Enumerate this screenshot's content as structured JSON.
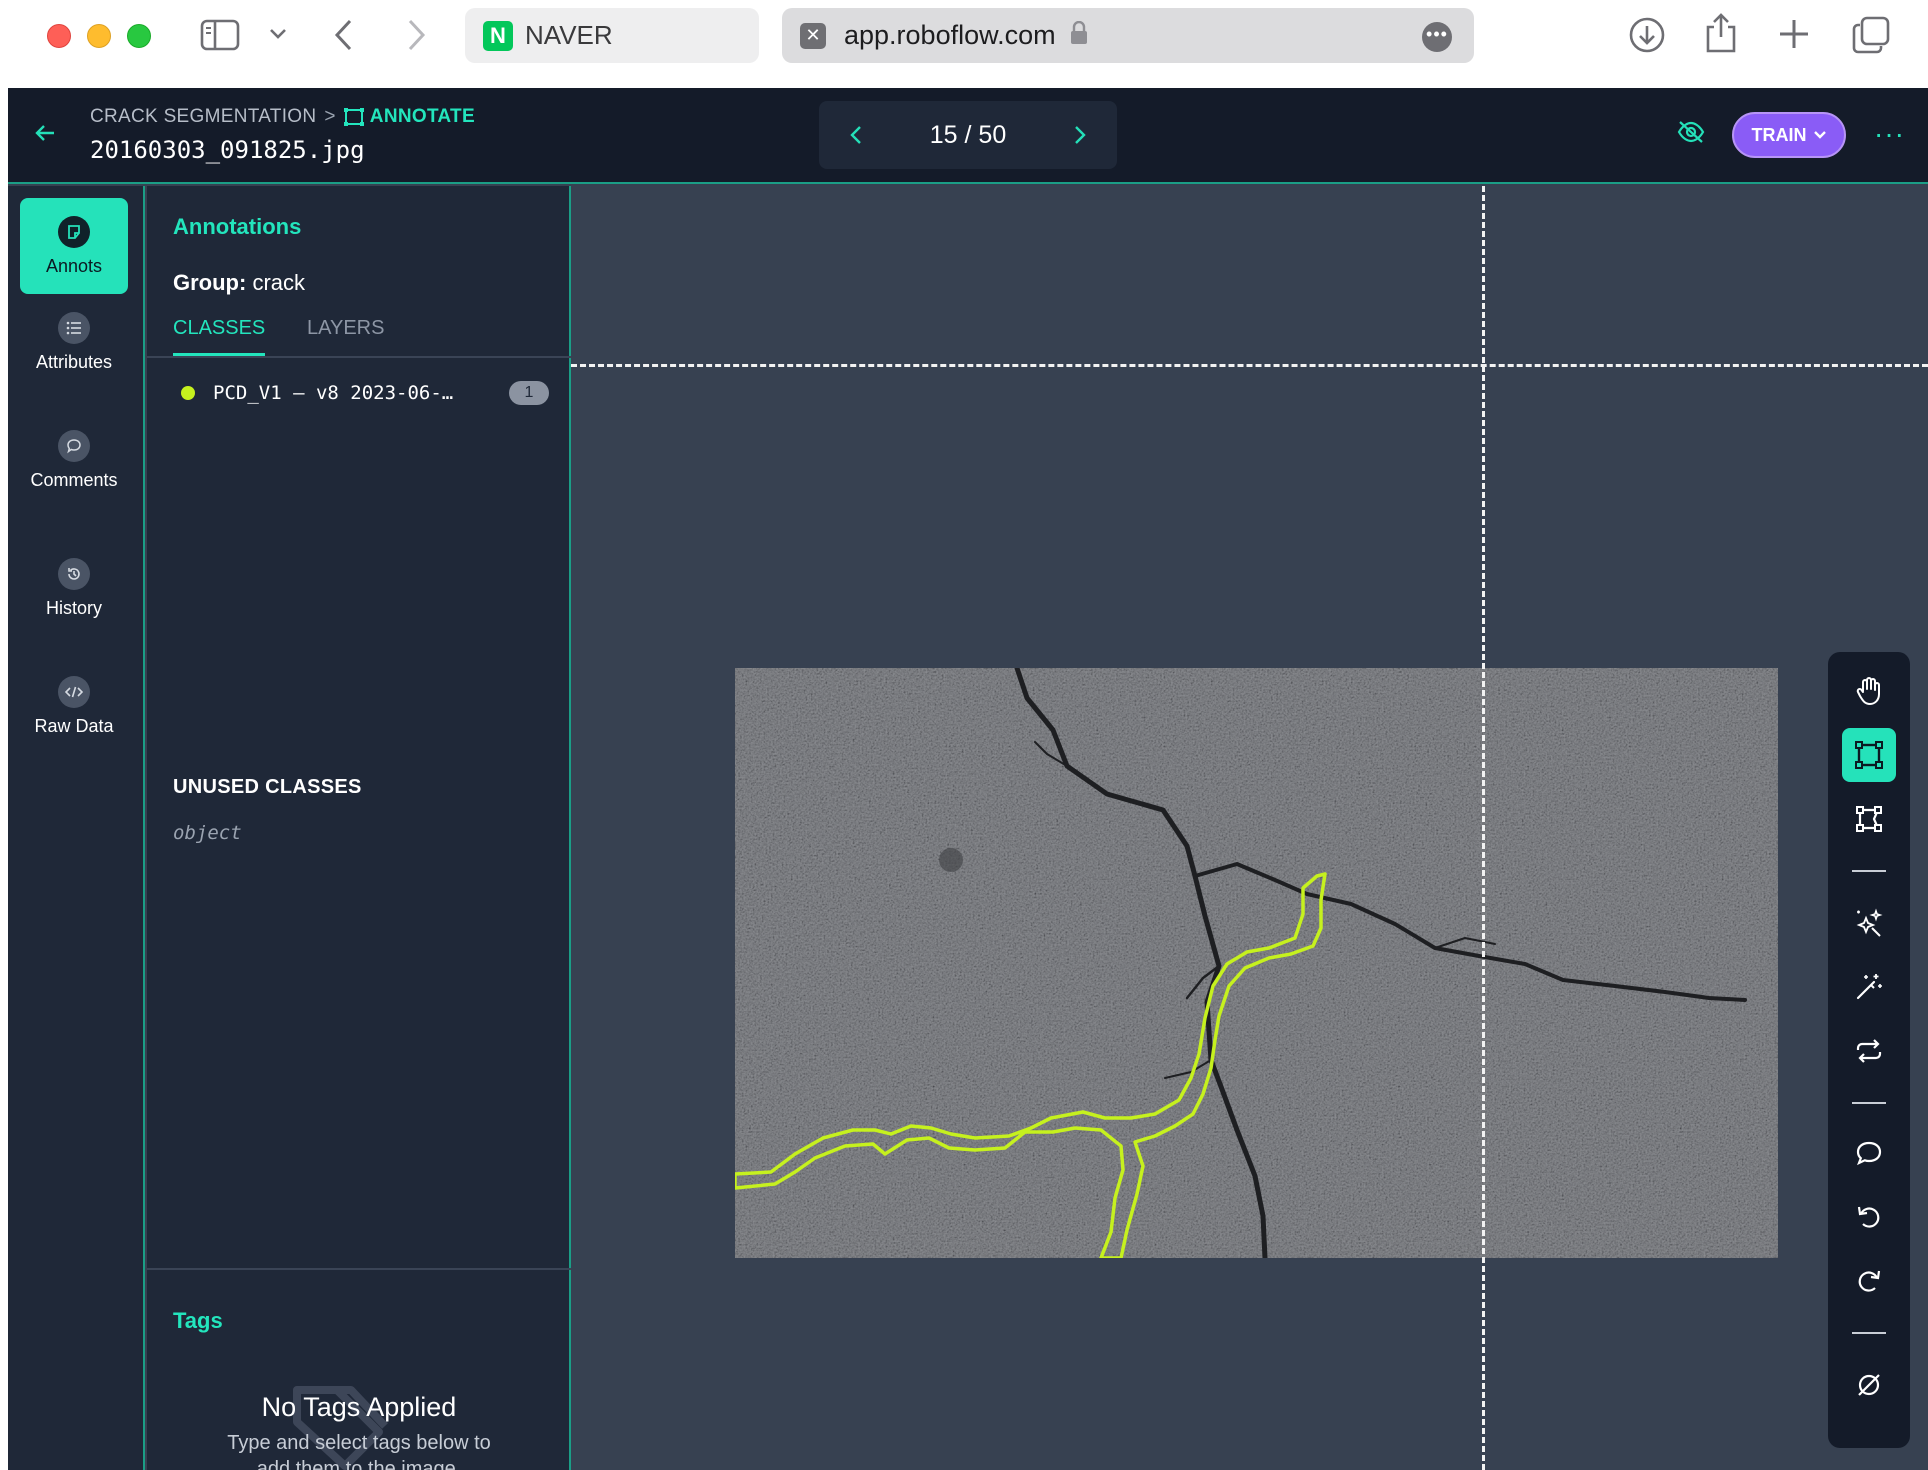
{
  "browser": {
    "tabs": [
      {
        "label": "NAVER",
        "icon": "naver-logo"
      },
      {
        "label": "app.roboflow.com",
        "icon": "close-icon"
      }
    ],
    "naver_logo_letter": "N",
    "more_dots": "•••"
  },
  "header": {
    "breadcrumb_project": "CRACK SEGMENTATION",
    "breadcrumb_separator": ">",
    "breadcrumb_current": "ANNOTATE",
    "file_name": "20160303_091825.jpg",
    "pager": "15 / 50",
    "train_label": "TRAIN",
    "more_label": "···"
  },
  "left_nav": {
    "items": [
      {
        "label": "Annots",
        "icon": "annotation-icon",
        "active": true
      },
      {
        "label": "Attributes",
        "icon": "list-icon"
      },
      {
        "label": "Comments",
        "icon": "comment-icon"
      },
      {
        "label": "History",
        "icon": "history-icon"
      },
      {
        "label": "Raw Data",
        "icon": "code-icon"
      }
    ]
  },
  "panel": {
    "title": "Annotations",
    "group_label": "Group:",
    "group_value": "crack",
    "tabs": [
      "CLASSES",
      "LAYERS"
    ],
    "classes": [
      {
        "name": "PCD_V1 – v8 2023-06-…",
        "count": "1",
        "color": "#c6f11e"
      }
    ],
    "unused_heading": "UNUSED CLASSES",
    "unused_classes": [
      "object"
    ],
    "tags_title": "Tags",
    "no_tags_title": "No Tags Applied",
    "no_tags_desc_1": "Type and select tags below to",
    "no_tags_desc_2": "add them to the image."
  },
  "toolbar": {
    "tools": [
      "hand-icon",
      "bounding-box-icon",
      "polygon-icon",
      "smart-polygon-icon",
      "magic-wand-icon",
      "repeat-icon",
      "comment-icon",
      "undo-icon",
      "redo-icon",
      "clear-icon"
    ],
    "active_tool": "bounding-box-icon"
  },
  "colors": {
    "accent": "#25e2ba",
    "header_bg": "#141b29",
    "panel_bg": "#1f2838",
    "canvas_bg": "#374151",
    "train": "#8a5cf6",
    "annotation": "#c6f11e"
  }
}
